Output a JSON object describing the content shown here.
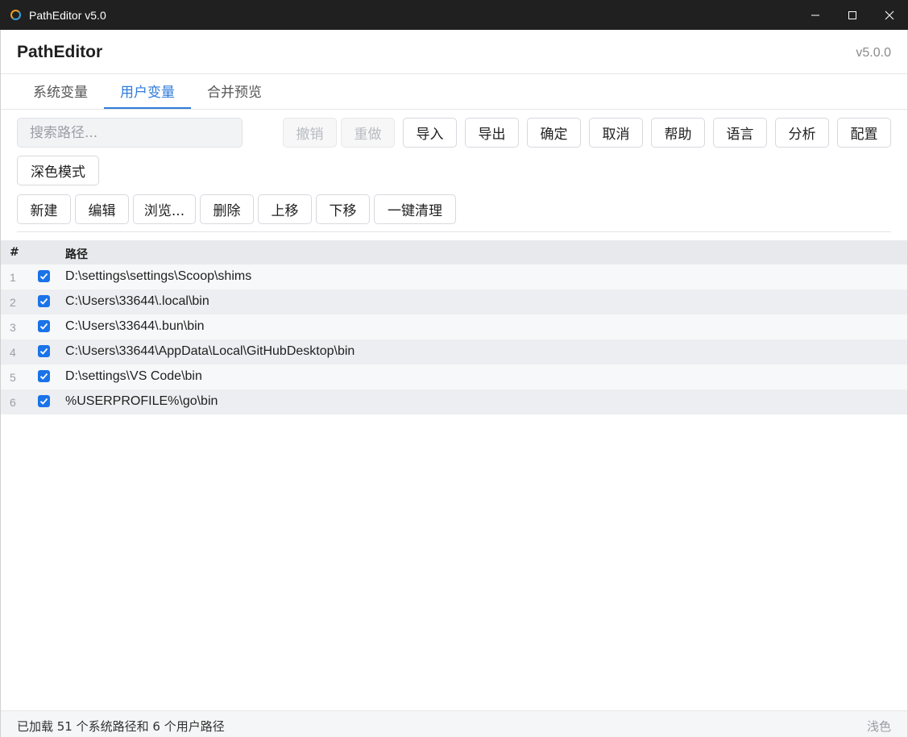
{
  "window": {
    "title": "PathEditor v5.0",
    "controls": [
      "minimize-icon",
      "maximize-icon",
      "close-icon"
    ]
  },
  "header": {
    "app_name": "PathEditor",
    "version": "v5.0.0"
  },
  "tabs": [
    {
      "label": "系统变量",
      "active": false
    },
    {
      "label": "用户变量",
      "active": true
    },
    {
      "label": "合并预览",
      "active": false
    }
  ],
  "toolbar": {
    "search_placeholder": "搜索路径...",
    "undo_label": "撤销",
    "redo_label": "重做",
    "import_label": "导入",
    "export_label": "导出",
    "ok_label": "确定",
    "cancel_label": "取消",
    "help_label": "帮助",
    "language_label": "语言",
    "analyze_label": "分析",
    "config_label": "配置",
    "dark_mode_label": "深色模式"
  },
  "actions": {
    "new_label": "新建",
    "edit_label": "编辑",
    "browse_label": "浏览...",
    "delete_label": "删除",
    "move_up_label": "上移",
    "move_down_label": "下移",
    "cleanup_label": "一键清理"
  },
  "table": {
    "headers": {
      "num": "#",
      "path": "路径"
    },
    "rows": [
      {
        "num": "1",
        "checked": true,
        "path": "D:\\settings\\settings\\Scoop\\shims"
      },
      {
        "num": "2",
        "checked": true,
        "path": "C:\\Users\\33644\\.local\\bin"
      },
      {
        "num": "3",
        "checked": true,
        "path": "C:\\Users\\33644\\.bun\\bin"
      },
      {
        "num": "4",
        "checked": true,
        "path": "C:\\Users\\33644\\AppData\\Local\\GitHubDesktop\\bin"
      },
      {
        "num": "5",
        "checked": true,
        "path": "D:\\settings\\VS Code\\bin"
      },
      {
        "num": "6",
        "checked": true,
        "path": "%USERPROFILE%\\go\\bin"
      }
    ]
  },
  "status": {
    "message": "已加载 51 个系统路径和 6 个用户路径",
    "theme": "浅色"
  },
  "colors": {
    "accent": "#2f7bd8",
    "checkbox": "#1a73e8",
    "titlebar": "#202020"
  }
}
